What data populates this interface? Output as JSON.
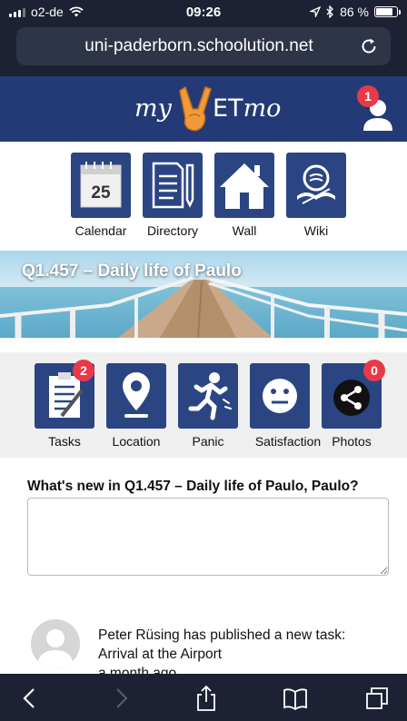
{
  "status_bar": {
    "carrier": "o2-de",
    "time": "09:26",
    "battery_text": "86 %",
    "battery_level": 0.86
  },
  "browser": {
    "url": "uni-paderborn.schoolution.net"
  },
  "app_header": {
    "logo_my": "my",
    "logo_et": "ET",
    "logo_mo": "mo",
    "notification_count": "1"
  },
  "top_nav": {
    "calendar_day": "25",
    "items": [
      {
        "label": "Calendar",
        "icon": "calendar-icon"
      },
      {
        "label": "Directory",
        "icon": "directory-icon"
      },
      {
        "label": "Wall",
        "icon": "house-icon"
      },
      {
        "label": "Wiki",
        "icon": "wiki-icon"
      }
    ]
  },
  "banner": {
    "title": "Q1.457 – Daily life of Paulo"
  },
  "actions": {
    "items": [
      {
        "label": "Tasks",
        "icon": "tasks-icon",
        "badge": "2"
      },
      {
        "label": "Location",
        "icon": "location-pin-icon"
      },
      {
        "label": "Panic",
        "icon": "panic-runner-icon"
      },
      {
        "label": "Satisfaction",
        "icon": "smiley-icon"
      },
      {
        "label": "Photos",
        "icon": "share-icon",
        "badge": "0"
      }
    ]
  },
  "post": {
    "question": "What's new in Q1.457 – Daily life of Paulo, Paulo?",
    "value": ""
  },
  "feed": {
    "items": [
      {
        "line1": "Peter Rüsing has published a new task:",
        "line2": "Arrival at the Airport",
        "line3": "a month ago"
      }
    ]
  },
  "colors": {
    "brand_blue": "#233a76",
    "tile_blue": "#2b4583",
    "badge_red": "#e8394a",
    "chrome_dark": "#1c2233"
  }
}
